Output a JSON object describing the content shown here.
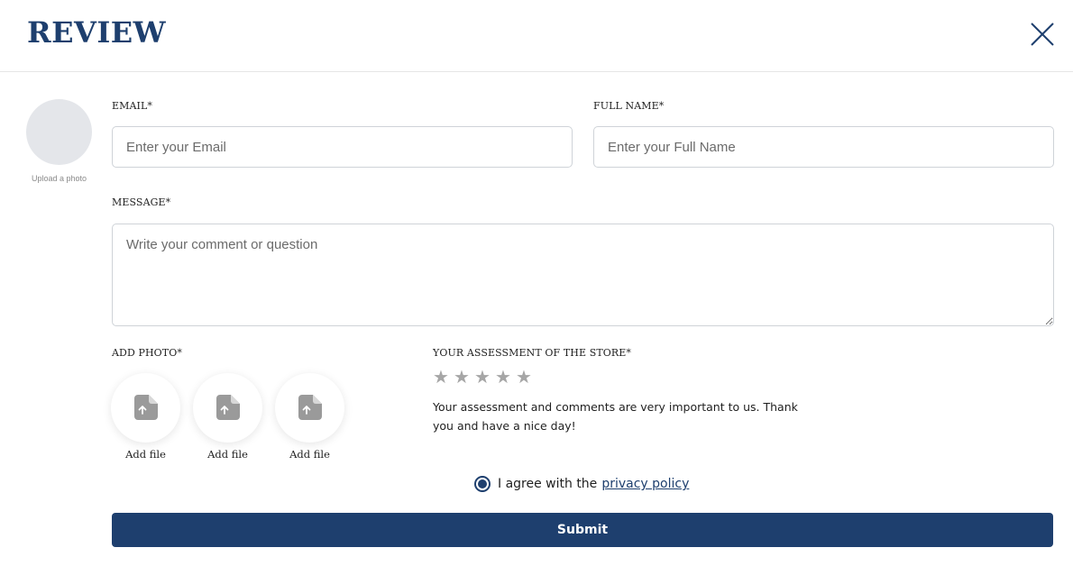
{
  "header": {
    "title": "REVIEW"
  },
  "avatar": {
    "label": "Upload a photo"
  },
  "form": {
    "email": {
      "label": "EMAIL*",
      "placeholder": "Enter your Email",
      "value": ""
    },
    "full_name": {
      "label": "FULL NAME*",
      "placeholder": "Enter your Full Name",
      "value": ""
    },
    "message": {
      "label": "MESSAGE*",
      "placeholder": "Write your comment or question",
      "value": ""
    },
    "add_photo": {
      "label": "ADD PHOTO*",
      "slots": [
        {
          "label": "Add file"
        },
        {
          "label": "Add file"
        },
        {
          "label": "Add file"
        }
      ]
    },
    "assessment": {
      "label": "YOUR ASSESSMENT OF THE STORE*",
      "rating": 0,
      "max_rating": 5,
      "note": "Your assessment and comments are very important to us. Thank you and have a nice day!"
    },
    "agree": {
      "text": "I agree with the",
      "link": "privacy policy",
      "checked": true
    },
    "submit_label": "Submit"
  },
  "colors": {
    "brand": "#1e3f6e",
    "star_empty": "#a6a6a6",
    "avatar_bg": "#e4e6ea",
    "upload_icon": "#9a9a9a"
  },
  "icons": {
    "close": "close-icon",
    "upload": "upload-file-icon",
    "star": "star-icon"
  }
}
